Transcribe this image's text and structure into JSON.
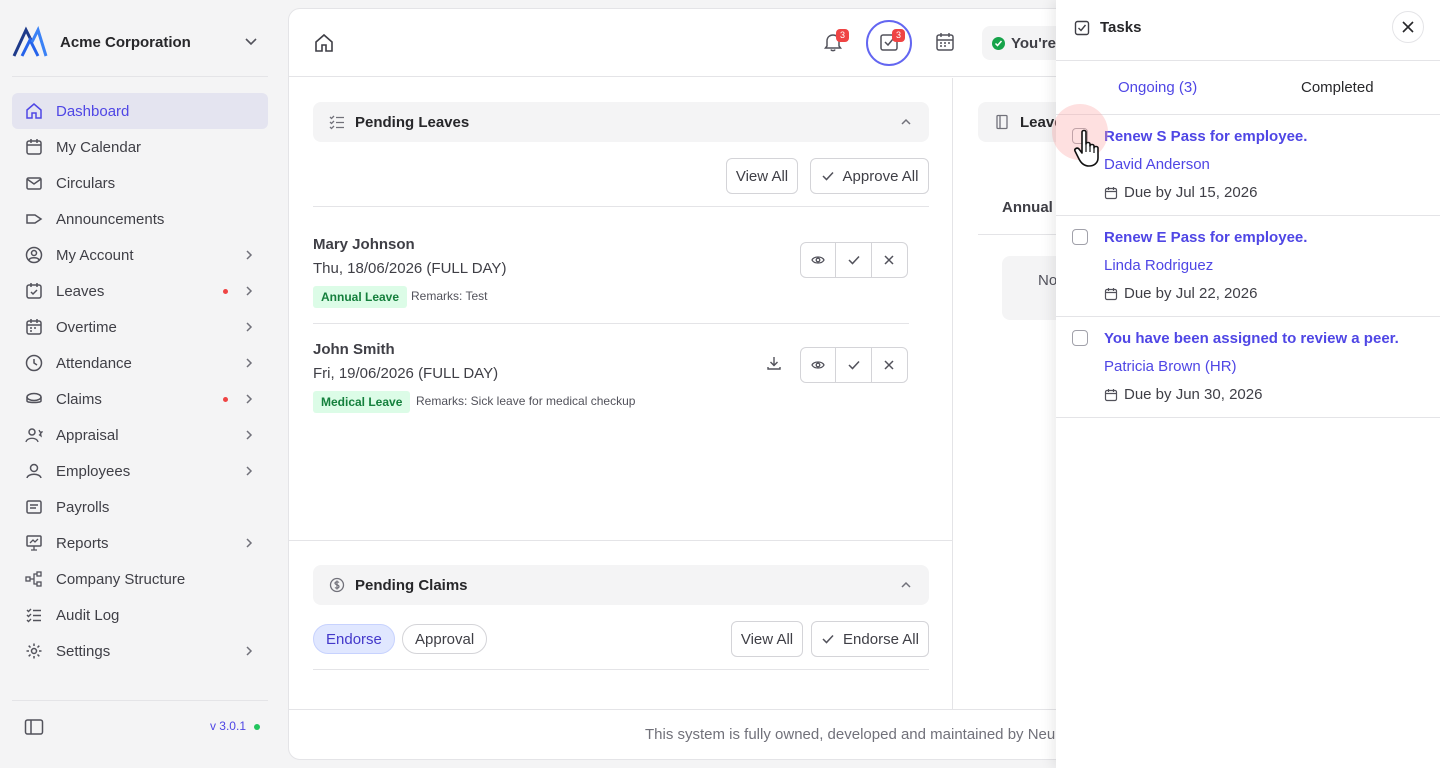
{
  "org": {
    "name": "Acme Corporation"
  },
  "sidebar": {
    "items": [
      {
        "label": "Dashboard"
      },
      {
        "label": "My Calendar"
      },
      {
        "label": "Circulars"
      },
      {
        "label": "Announcements"
      },
      {
        "label": "My Account"
      },
      {
        "label": "Leaves"
      },
      {
        "label": "Overtime"
      },
      {
        "label": "Attendance"
      },
      {
        "label": "Claims"
      },
      {
        "label": "Appraisal"
      },
      {
        "label": "Employees"
      },
      {
        "label": "Payrolls"
      },
      {
        "label": "Reports"
      },
      {
        "label": "Company Structure"
      },
      {
        "label": "Audit Log"
      },
      {
        "label": "Settings"
      }
    ],
    "version": "v 3.0.1"
  },
  "topbar": {
    "notifications_count": "3",
    "tasks_count": "3",
    "status_text": "You're"
  },
  "pending_leaves": {
    "title": "Pending Leaves",
    "view_all": "View All",
    "approve_all": "Approve All",
    "rows": [
      {
        "name": "Mary Johnson",
        "date": "Thu, 18/06/2026 (FULL DAY)",
        "type": "Annual Leave",
        "remarks": "Remarks: Test"
      },
      {
        "name": "John Smith",
        "date": "Fri, 19/06/2026 (FULL DAY)",
        "type": "Medical Leave",
        "remarks": "Remarks: Sick leave for medical checkup"
      }
    ]
  },
  "pending_claims": {
    "title": "Pending Claims",
    "chip_endorse": "Endorse",
    "chip_approval": "Approval",
    "view_all": "View All",
    "endorse_all": "Endorse All"
  },
  "right_panel": {
    "head": "Leave",
    "annual": "Annual L",
    "nodata": "No"
  },
  "footer": {
    "text": "This system is fully owned, developed and maintained by Neuh"
  },
  "tasks_drawer": {
    "title": "Tasks",
    "tab_ongoing": "Ongoing (3)",
    "tab_completed": "Completed",
    "tasks": [
      {
        "title": "Renew S Pass for employee.",
        "who": "David Anderson",
        "due": "Due by Jul 15, 2026"
      },
      {
        "title": "Renew E Pass for employee.",
        "who": "Linda Rodriguez",
        "due": "Due by Jul 22, 2026"
      },
      {
        "title": "You have been assigned to review a peer.",
        "who": "Patricia Brown (HR)",
        "due": "Due by Jun 30, 2026"
      }
    ]
  },
  "colors": {
    "accent": "#4f46e5",
    "success": "#16a34a",
    "danger": "#ef4444"
  }
}
